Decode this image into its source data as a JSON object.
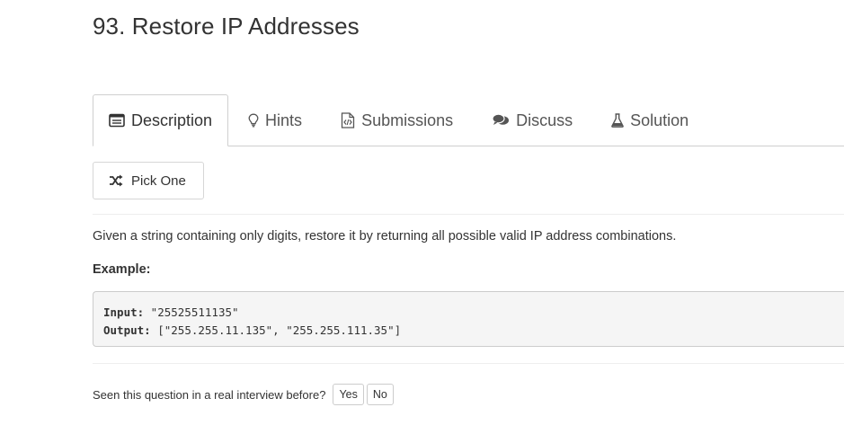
{
  "problem": {
    "title": "93. Restore IP Addresses"
  },
  "tabs": [
    {
      "label": "Description",
      "icon": "list-icon",
      "active": true
    },
    {
      "label": "Hints",
      "icon": "lightbulb-icon",
      "active": false
    },
    {
      "label": "Submissions",
      "icon": "code-file-icon",
      "active": false
    },
    {
      "label": "Discuss",
      "icon": "comments-icon",
      "active": false
    },
    {
      "label": "Solution",
      "icon": "flask-icon",
      "active": false
    }
  ],
  "pick_one": {
    "label": "Pick One",
    "icon": "shuffle-icon"
  },
  "description": {
    "text": "Given a string containing only digits, restore it by returning all possible valid IP address combinations.",
    "example_label": "Example:",
    "input_key": "Input:",
    "input_value": " \"25525511135\"",
    "output_key": "Output:",
    "output_value": " [\"255.255.11.135\", \"255.255.111.35\"]"
  },
  "feedback": {
    "question": "Seen this question in a real interview before?",
    "yes_label": "Yes",
    "no_label": "No"
  },
  "colors": {
    "text": "#333333",
    "tab_border": "#cfcfcf",
    "code_bg": "#f5f5f5"
  }
}
